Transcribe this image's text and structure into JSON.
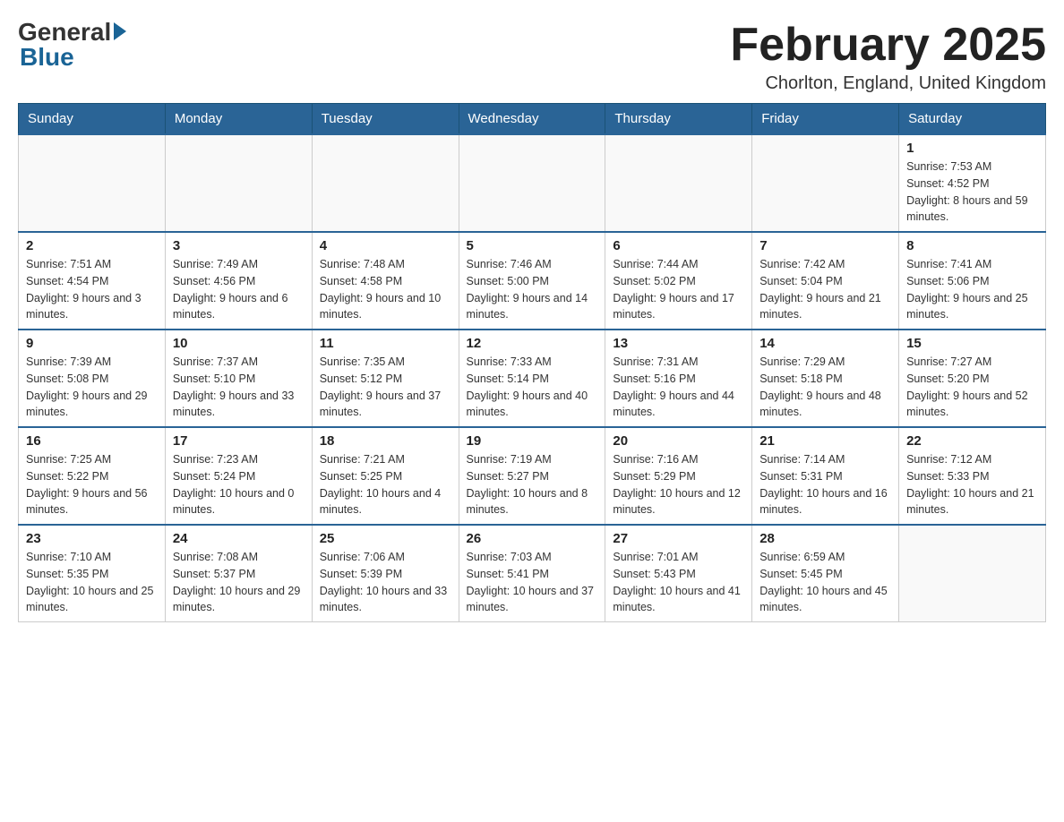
{
  "header": {
    "logo_general": "General",
    "logo_blue": "Blue",
    "month_title": "February 2025",
    "location": "Chorlton, England, United Kingdom"
  },
  "days_of_week": [
    "Sunday",
    "Monday",
    "Tuesday",
    "Wednesday",
    "Thursday",
    "Friday",
    "Saturday"
  ],
  "weeks": [
    [
      {
        "day": "",
        "info": ""
      },
      {
        "day": "",
        "info": ""
      },
      {
        "day": "",
        "info": ""
      },
      {
        "day": "",
        "info": ""
      },
      {
        "day": "",
        "info": ""
      },
      {
        "day": "",
        "info": ""
      },
      {
        "day": "1",
        "info": "Sunrise: 7:53 AM\nSunset: 4:52 PM\nDaylight: 8 hours and 59 minutes."
      }
    ],
    [
      {
        "day": "2",
        "info": "Sunrise: 7:51 AM\nSunset: 4:54 PM\nDaylight: 9 hours and 3 minutes."
      },
      {
        "day": "3",
        "info": "Sunrise: 7:49 AM\nSunset: 4:56 PM\nDaylight: 9 hours and 6 minutes."
      },
      {
        "day": "4",
        "info": "Sunrise: 7:48 AM\nSunset: 4:58 PM\nDaylight: 9 hours and 10 minutes."
      },
      {
        "day": "5",
        "info": "Sunrise: 7:46 AM\nSunset: 5:00 PM\nDaylight: 9 hours and 14 minutes."
      },
      {
        "day": "6",
        "info": "Sunrise: 7:44 AM\nSunset: 5:02 PM\nDaylight: 9 hours and 17 minutes."
      },
      {
        "day": "7",
        "info": "Sunrise: 7:42 AM\nSunset: 5:04 PM\nDaylight: 9 hours and 21 minutes."
      },
      {
        "day": "8",
        "info": "Sunrise: 7:41 AM\nSunset: 5:06 PM\nDaylight: 9 hours and 25 minutes."
      }
    ],
    [
      {
        "day": "9",
        "info": "Sunrise: 7:39 AM\nSunset: 5:08 PM\nDaylight: 9 hours and 29 minutes."
      },
      {
        "day": "10",
        "info": "Sunrise: 7:37 AM\nSunset: 5:10 PM\nDaylight: 9 hours and 33 minutes."
      },
      {
        "day": "11",
        "info": "Sunrise: 7:35 AM\nSunset: 5:12 PM\nDaylight: 9 hours and 37 minutes."
      },
      {
        "day": "12",
        "info": "Sunrise: 7:33 AM\nSunset: 5:14 PM\nDaylight: 9 hours and 40 minutes."
      },
      {
        "day": "13",
        "info": "Sunrise: 7:31 AM\nSunset: 5:16 PM\nDaylight: 9 hours and 44 minutes."
      },
      {
        "day": "14",
        "info": "Sunrise: 7:29 AM\nSunset: 5:18 PM\nDaylight: 9 hours and 48 minutes."
      },
      {
        "day": "15",
        "info": "Sunrise: 7:27 AM\nSunset: 5:20 PM\nDaylight: 9 hours and 52 minutes."
      }
    ],
    [
      {
        "day": "16",
        "info": "Sunrise: 7:25 AM\nSunset: 5:22 PM\nDaylight: 9 hours and 56 minutes."
      },
      {
        "day": "17",
        "info": "Sunrise: 7:23 AM\nSunset: 5:24 PM\nDaylight: 10 hours and 0 minutes."
      },
      {
        "day": "18",
        "info": "Sunrise: 7:21 AM\nSunset: 5:25 PM\nDaylight: 10 hours and 4 minutes."
      },
      {
        "day": "19",
        "info": "Sunrise: 7:19 AM\nSunset: 5:27 PM\nDaylight: 10 hours and 8 minutes."
      },
      {
        "day": "20",
        "info": "Sunrise: 7:16 AM\nSunset: 5:29 PM\nDaylight: 10 hours and 12 minutes."
      },
      {
        "day": "21",
        "info": "Sunrise: 7:14 AM\nSunset: 5:31 PM\nDaylight: 10 hours and 16 minutes."
      },
      {
        "day": "22",
        "info": "Sunrise: 7:12 AM\nSunset: 5:33 PM\nDaylight: 10 hours and 21 minutes."
      }
    ],
    [
      {
        "day": "23",
        "info": "Sunrise: 7:10 AM\nSunset: 5:35 PM\nDaylight: 10 hours and 25 minutes."
      },
      {
        "day": "24",
        "info": "Sunrise: 7:08 AM\nSunset: 5:37 PM\nDaylight: 10 hours and 29 minutes."
      },
      {
        "day": "25",
        "info": "Sunrise: 7:06 AM\nSunset: 5:39 PM\nDaylight: 10 hours and 33 minutes."
      },
      {
        "day": "26",
        "info": "Sunrise: 7:03 AM\nSunset: 5:41 PM\nDaylight: 10 hours and 37 minutes."
      },
      {
        "day": "27",
        "info": "Sunrise: 7:01 AM\nSunset: 5:43 PM\nDaylight: 10 hours and 41 minutes."
      },
      {
        "day": "28",
        "info": "Sunrise: 6:59 AM\nSunset: 5:45 PM\nDaylight: 10 hours and 45 minutes."
      },
      {
        "day": "",
        "info": ""
      }
    ]
  ]
}
